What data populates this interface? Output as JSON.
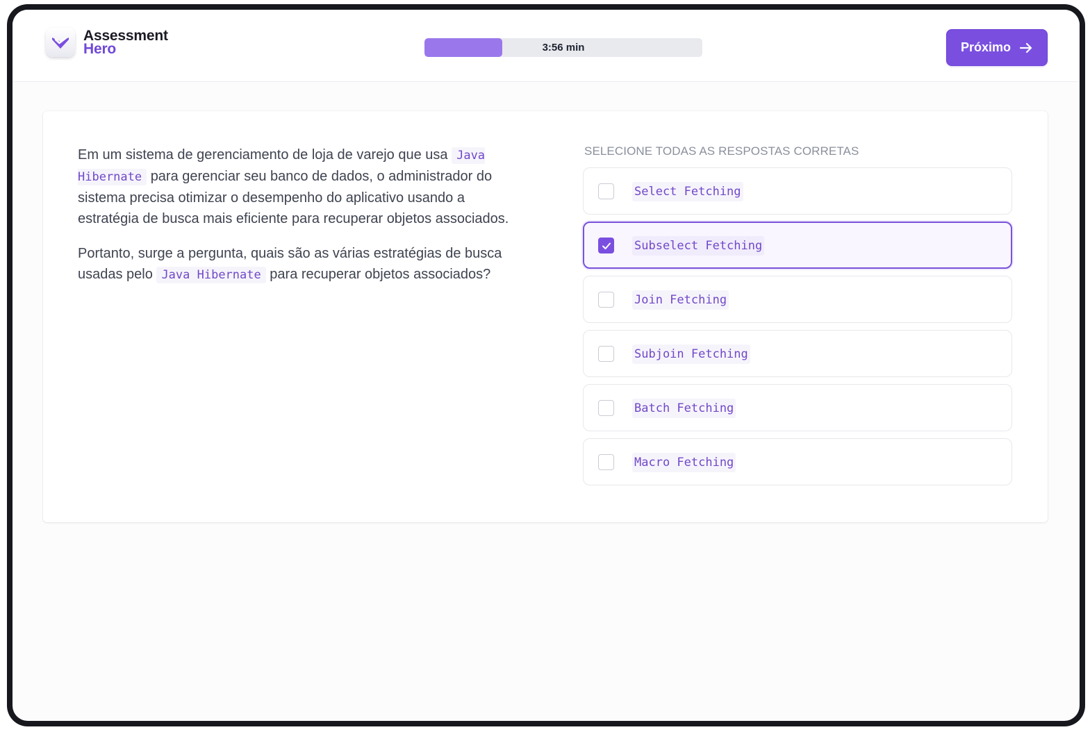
{
  "app": {
    "name_line1": "Assessment",
    "name_line2": "Hero",
    "logo_icon": "check-shield-icon"
  },
  "timer": {
    "label": "3:56 min",
    "progress": 0.28
  },
  "header": {
    "next_label": "Próximo",
    "next_icon": "arrow-right-icon"
  },
  "question": {
    "p1_before": "Em um sistema de gerenciamento de loja de varejo que usa",
    "p1_code": "Java Hibernate",
    "p1_after": "para gerenciar seu banco de dados, o administrador do sistema precisa otimizar o desempenho do aplicativo usando a estratégia de busca mais eficiente para recuperar objetos associados.",
    "p2_before": "Portanto, surge a pergunta, quais são as várias estratégias de busca usadas pelo",
    "p2_code": "Java Hibernate",
    "p2_after": "para recuperar objetos associados?"
  },
  "answers": {
    "title": "SELECIONE TODAS AS RESPOSTAS CORRETAS",
    "options": [
      {
        "label": "Select Fetching",
        "checked": false
      },
      {
        "label": "Subselect Fetching",
        "checked": true
      },
      {
        "label": "Join Fetching",
        "checked": false
      },
      {
        "label": "Subjoin Fetching",
        "checked": false
      },
      {
        "label": "Batch Fetching",
        "checked": false
      },
      {
        "label": "Macro Fetching",
        "checked": false
      }
    ]
  },
  "colors": {
    "accent": "#7a4fe0",
    "progress_fill": "#9a78ec",
    "code_text": "#7048c8"
  }
}
